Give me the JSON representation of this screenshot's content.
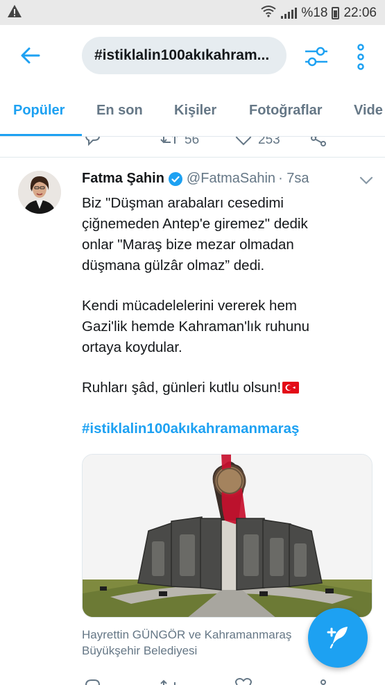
{
  "status_bar": {
    "alert_icon": "warning-triangle-icon",
    "wifi_icon": "wifi-icon",
    "signal_icon": "signal-bars-icon",
    "battery": "%18",
    "time": "22:06"
  },
  "header": {
    "back_icon": "back-arrow-icon",
    "search_query": "#istiklalin100akıkahram...",
    "filter_icon": "filter-sliders-icon",
    "more_icon": "more-vertical-icon"
  },
  "tabs": [
    {
      "label": "Popüler",
      "active": true
    },
    {
      "label": "En son",
      "active": false
    },
    {
      "label": "Kişiler",
      "active": false
    },
    {
      "label": "Fotoğraflar",
      "active": false
    },
    {
      "label": "Vide",
      "active": false
    }
  ],
  "previous_tweet_actions": {
    "retweets": "56",
    "likes": "253"
  },
  "tweet": {
    "name": "Fatma Şahin",
    "handle": "@FatmaSahin",
    "time": "· 7sa",
    "text_lines_1": [
      "Biz \"Düşman arabaları cesedimi",
      "çiğnemeden Antep'e giremez\" dedik",
      "onlar \"Maraş bize mezar olmadan",
      "düşmana gülzâr olmaz” dedi."
    ],
    "text_lines_2": [
      "Kendi mücadelelerini vererek hem",
      "Gazi'lik hemde Kahraman'lık ruhunu",
      "ortaya koydular."
    ],
    "text_lines_3": [
      "Ruhları şâd, günleri kutlu olsun!"
    ],
    "hashtag": "#istiklalin100akıkahramanmaraş",
    "caption_line1": "Hayrettin GÜNGÖR ve Kahramanmaraş",
    "caption_line2": "Büyükşehir Belediyesi"
  },
  "colors": {
    "accent": "#1da1f2",
    "text": "#14171a",
    "muted": "#657786",
    "divider": "#e1e8ed"
  }
}
